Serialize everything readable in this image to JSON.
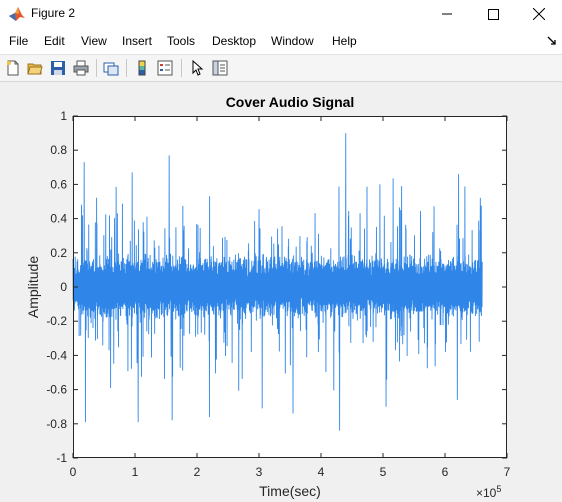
{
  "window": {
    "title": "Figure 2"
  },
  "menu": {
    "items": [
      "File",
      "Edit",
      "View",
      "Insert",
      "Tools",
      "Desktop",
      "Window",
      "Help"
    ]
  },
  "toolbar": {
    "buttons": [
      "new-figure-icon",
      "open-file-icon",
      "save-icon",
      "print-icon",
      "link-plot-icon",
      "colorbar-icon",
      "legend-icon",
      "pointer-icon",
      "property-inspector-icon"
    ]
  },
  "colors": {
    "signal": "#2f86e8",
    "background": "#f0f0f0",
    "axes_background": "#ffffff"
  },
  "chart_data": {
    "type": "line",
    "title": "Cover Audio Signal",
    "xlabel": "Time(sec)",
    "ylabel": "Amplitude",
    "x_exponent_label": "×10",
    "x_exponent_power": "5",
    "xlim": [
      0,
      7
    ],
    "ylim": [
      -1,
      1
    ],
    "x_ticks": [
      "0",
      "1",
      "2",
      "3",
      "4",
      "5",
      "6",
      "7"
    ],
    "y_ticks": [
      "1",
      "0.8",
      "0.6",
      "0.4",
      "0.2",
      "0",
      "-0.2",
      "-0.4",
      "-0.6",
      "-0.8",
      "-1"
    ],
    "x_tick_values": [
      0,
      1,
      2,
      3,
      4,
      5,
      6,
      7
    ],
    "y_tick_values": [
      1,
      0.8,
      0.6,
      0.4,
      0.2,
      0,
      -0.2,
      -0.4,
      -0.6,
      -0.8,
      -1
    ],
    "series": [
      {
        "x_start": 0.0,
        "x_end": 6.6,
        "baseline_envelope": 0.2,
        "peak_max": 0.9,
        "peak_min": -0.84,
        "notable_peaks": [
          {
            "x": 0.18,
            "y": 0.73
          },
          {
            "x": 0.2,
            "y": -0.79
          },
          {
            "x": 1.05,
            "y": -0.79
          },
          {
            "x": 1.55,
            "y": 0.77
          },
          {
            "x": 1.6,
            "y": -0.78
          },
          {
            "x": 2.2,
            "y": -0.76
          },
          {
            "x": 3.05,
            "y": -0.71
          },
          {
            "x": 3.55,
            "y": -0.74
          },
          {
            "x": 4.3,
            "y": 0.61
          },
          {
            "x": 4.4,
            "y": 0.9
          },
          {
            "x": 4.3,
            "y": -0.84
          },
          {
            "x": 4.95,
            "y": 0.6
          },
          {
            "x": 5.05,
            "y": -0.7
          },
          {
            "x": 5.3,
            "y": 0.59
          },
          {
            "x": 6.22,
            "y": 0.66
          },
          {
            "x": 6.2,
            "y": -0.66
          }
        ]
      }
    ]
  }
}
